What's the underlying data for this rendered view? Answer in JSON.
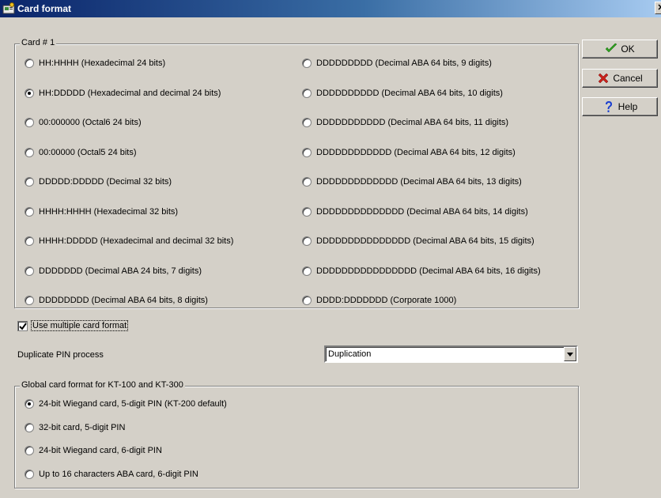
{
  "window": {
    "title": "Card format",
    "close_glyph": "✕"
  },
  "card_group": {
    "legend": "Card # 1",
    "options_left": [
      {
        "label": "HH:HHHH (Hexadecimal 24 bits)",
        "checked": false
      },
      {
        "label": "HH:DDDDD (Hexadecimal and decimal 24 bits)",
        "checked": true
      },
      {
        "label": "00:000000 (Octal6 24 bits)",
        "checked": false
      },
      {
        "label": "00:00000 (Octal5 24 bits)",
        "checked": false
      },
      {
        "label": "DDDDD:DDDDD (Decimal 32 bits)",
        "checked": false
      },
      {
        "label": "HHHH:HHHH (Hexadecimal 32 bits)",
        "checked": false
      },
      {
        "label": "HHHH:DDDDD (Hexadecimal and decimal 32 bits)",
        "checked": false
      },
      {
        "label": "DDDDDDD (Decimal ABA 24 bits, 7 digits)",
        "checked": false
      },
      {
        "label": "DDDDDDDD (Decimal ABA 64 bits, 8 digits)",
        "checked": false
      }
    ],
    "options_right": [
      {
        "label": "DDDDDDDDD (Decimal ABA 64 bits, 9 digits)",
        "checked": false
      },
      {
        "label": "DDDDDDDDDD (Decimal ABA 64 bits, 10 digits)",
        "checked": false
      },
      {
        "label": "DDDDDDDDDDD (Decimal ABA 64 bits, 11 digits)",
        "checked": false
      },
      {
        "label": "DDDDDDDDDDDD (Decimal ABA 64 bits, 12 digits)",
        "checked": false
      },
      {
        "label": "DDDDDDDDDDDDD (Decimal ABA 64 bits, 13 digits)",
        "checked": false
      },
      {
        "label": "DDDDDDDDDDDDDD (Decimal ABA 64 bits, 14 digits)",
        "checked": false
      },
      {
        "label": "DDDDDDDDDDDDDDD (Decimal ABA 64 bits, 15 digits)",
        "checked": false
      },
      {
        "label": "DDDDDDDDDDDDDDDD (Decimal ABA 64 bits, 16 digits)",
        "checked": false
      },
      {
        "label": "DDDD:DDDDDDD (Corporate 1000)",
        "checked": false
      }
    ]
  },
  "buttons": {
    "ok": "OK",
    "cancel": "Cancel",
    "help": "Help"
  },
  "multiple_format": {
    "label": "Use multiple card format",
    "checked": true
  },
  "duplicate_pin": {
    "label": "Duplicate PIN process",
    "value": "Duplication"
  },
  "global_group": {
    "legend": "Global card format for KT-100 and KT-300",
    "options": [
      {
        "label": "24-bit Wiegand card, 5-digit PIN (KT-200 default)",
        "checked": true
      },
      {
        "label": "32-bit card, 5-digit PIN",
        "checked": false
      },
      {
        "label": "24-bit Wiegand card, 6-digit PIN",
        "checked": false
      },
      {
        "label": "Up to 16 characters ABA card, 6-digit PIN",
        "checked": false
      }
    ]
  },
  "colors": {
    "title_gradient_start": "#0a246a",
    "title_gradient_end": "#a6caf0",
    "dialog_bg": "#d4d0c8",
    "ok_check": "#2e9e1f",
    "cancel_x": "#c8201a",
    "help_q": "#1a3fd0"
  },
  "icons": {
    "app": "card-app-icon",
    "ok": "checkmark-icon",
    "cancel": "x-icon",
    "help": "question-mark-icon",
    "dropdown": "chevron-down-icon"
  }
}
